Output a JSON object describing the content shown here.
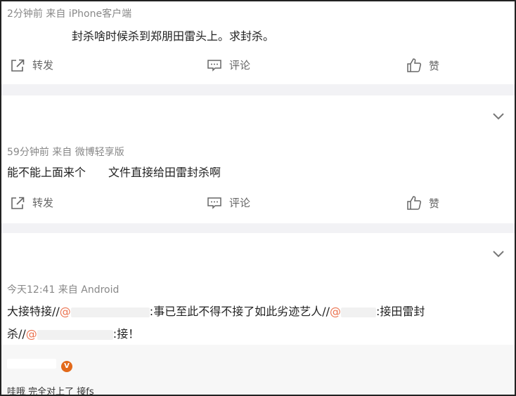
{
  "posts": [
    {
      "meta": "2分钟前  来自 iPhone客户端",
      "text": "封杀啥时候杀到郑朋田雷头上。求封杀。",
      "actions": {
        "forward": "转发",
        "comment": "评论",
        "like": "赞"
      }
    },
    {
      "meta": "59分钟前  来自 微博轻享版",
      "text_a": "能不能上面来个",
      "text_b": "文件直接给田雷封杀啊",
      "actions": {
        "forward": "转发",
        "comment": "评论",
        "like": "赞"
      }
    },
    {
      "meta": "今天12:41  来自 Android",
      "line1_a": "大接特接//",
      "mention_sign": "@",
      "line1_b": ":事已至此不得不接了如此劣迹艺人//",
      "line1_c": ":接田雷封",
      "line2_a": "杀//",
      "line2_b": ":接！"
    }
  ],
  "reply": {
    "badge": "V",
    "text": "哇哦 完全对上了 接fs"
  },
  "colors": {
    "mention": "#eb7350",
    "separator": "#f2f2f5",
    "badge": "#e2691a"
  }
}
